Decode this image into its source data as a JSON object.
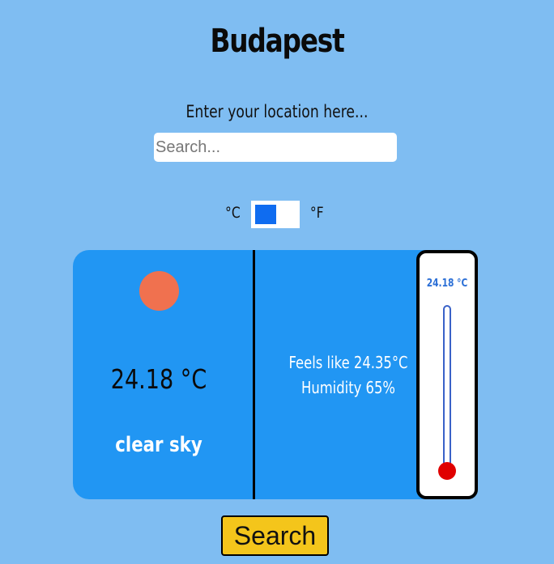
{
  "city": "Budapest",
  "search": {
    "prompt": "Enter your location here...",
    "placeholder": "Search...",
    "value": ""
  },
  "units": {
    "celsius_label": "°C",
    "fahrenheit_label": "°F",
    "selected": "°C",
    "toggle_color": "#0f6cf0"
  },
  "weather": {
    "icon": "sun-icon",
    "icon_color": "#f0714f",
    "temperature": "24.18 °C",
    "description": "clear sky",
    "feels_like": "Feels like 24.35°C",
    "humidity": "Humidity 65%"
  },
  "thermometer": {
    "reading": "24.18 °C",
    "bulb_color": "#e00000",
    "tube_color": "#3a62c8"
  },
  "search_button_label": "Search",
  "colors": {
    "background": "#7fbdf2",
    "card": "#2196f3",
    "button": "#f4c51b"
  }
}
